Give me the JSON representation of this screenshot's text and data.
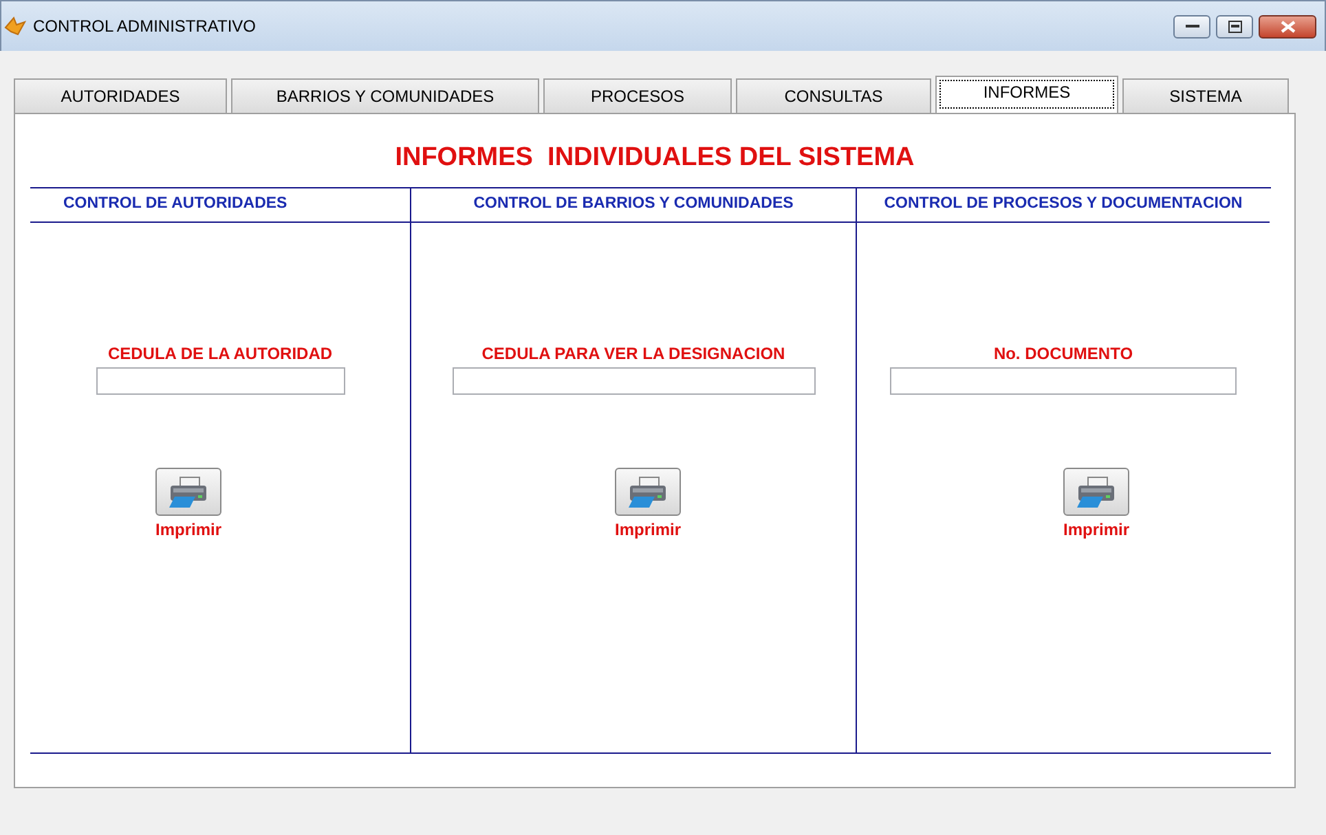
{
  "window": {
    "title": "CONTROL ADMINISTRATIVO"
  },
  "tabs": [
    {
      "label": "AUTORIDADES",
      "selected": false
    },
    {
      "label": "BARRIOS Y COMUNIDADES",
      "selected": false
    },
    {
      "label": "PROCESOS",
      "selected": false
    },
    {
      "label": "CONSULTAS",
      "selected": false
    },
    {
      "label": "INFORMES",
      "selected": true
    },
    {
      "label": "SISTEMA",
      "selected": false
    }
  ],
  "heading": "INFORMES  INDIVIDUALES DEL SISTEMA",
  "sections": [
    {
      "header": "CONTROL DE AUTORIDADES",
      "field_label": "CEDULA DE LA AUTORIDAD",
      "print_label": "Imprimir"
    },
    {
      "header": "CONTROL DE BARRIOS Y COMUNIDADES",
      "field_label": "CEDULA PARA VER LA DESIGNACION",
      "print_label": "Imprimir"
    },
    {
      "header": "CONTROL DE PROCESOS Y DOCUMENTACION",
      "field_label": "No. DOCUMENTO",
      "print_label": "Imprimir"
    }
  ]
}
